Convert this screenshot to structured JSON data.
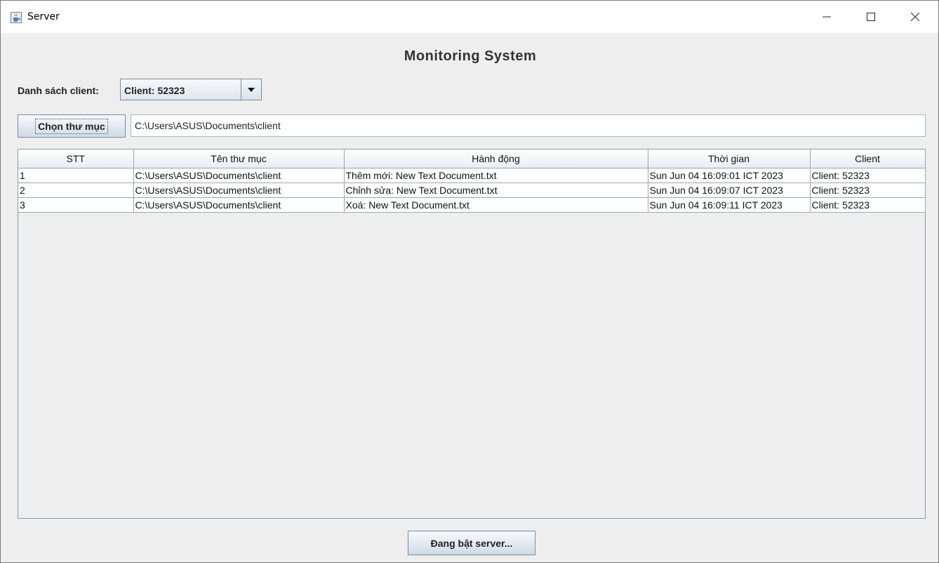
{
  "window": {
    "title": "Server",
    "icon": "java-cup-icon",
    "controls": [
      "minimize-icon",
      "maximize-icon",
      "close-icon"
    ]
  },
  "heading": "Monitoring System",
  "client_select": {
    "label": "Danh sách client:",
    "selected": "Client: 52323"
  },
  "folder": {
    "button_label": "Chọn thư mục",
    "path": "C:\\Users\\ASUS\\Documents\\client"
  },
  "table": {
    "headers": [
      "STT",
      "Tên thư mục",
      "Hành động",
      "Thời gian",
      "Client"
    ],
    "rows": [
      [
        "1",
        "C:\\Users\\ASUS\\Documents\\client",
        "Thêm mới: New Text Document.txt",
        "Sun Jun 04 16:09:01 ICT 2023",
        "Client: 52323"
      ],
      [
        "2",
        "C:\\Users\\ASUS\\Documents\\client",
        "Chỉnh sửa: New Text Document.txt",
        "Sun Jun 04 16:09:07 ICT 2023",
        "Client: 52323"
      ],
      [
        "3",
        "C:\\Users\\ASUS\\Documents\\client",
        "Xoá: New Text Document.txt",
        "Sun Jun 04 16:09:11 ICT 2023",
        "Client: 52323"
      ]
    ]
  },
  "server_button_label": "Đang bật server..."
}
